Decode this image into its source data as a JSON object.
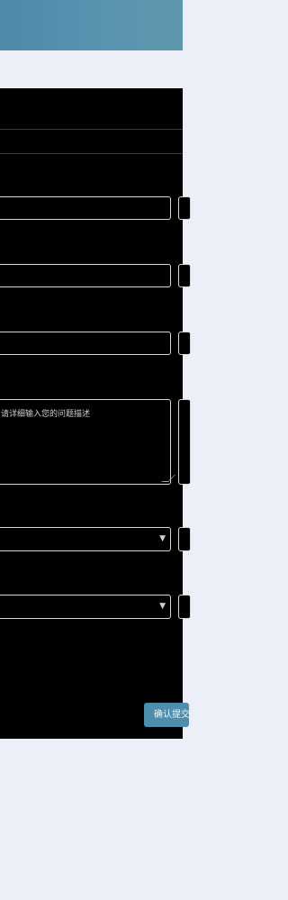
{
  "form": {
    "description_placeholder": "请详细输入您的问题描述",
    "submit_label": "确认提交"
  },
  "icons": {
    "select_chevron": "chevron-down-icon"
  },
  "colors": {
    "header_start": "#4f89a8",
    "header_end": "#5f97ad",
    "page_background": "#eceff8",
    "panel_background": "#000000",
    "submit_button": "#4e8dab"
  }
}
